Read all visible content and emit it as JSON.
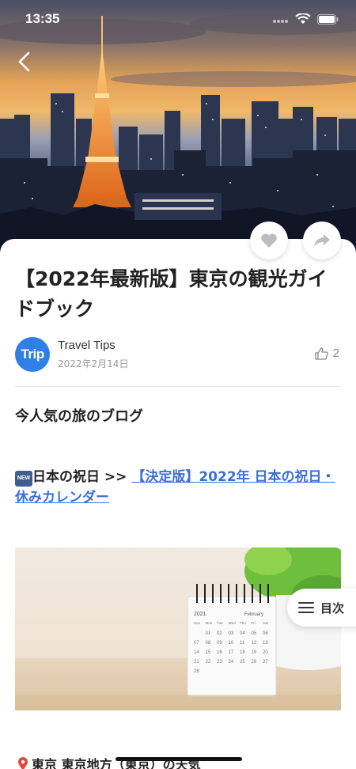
{
  "status_bar": {
    "time": "13:35"
  },
  "icons": {
    "back": "chevron-left-icon",
    "like": "heart-icon",
    "share": "share-arrow-icon",
    "thumbs_up": "thumbs-up-icon",
    "toc": "hamburger-menu-icon",
    "pin": "location-pin-icon"
  },
  "article": {
    "title": "【2022年最新版】東京の観光ガイドブック",
    "author": {
      "avatar_text": "Trip",
      "name": "Travel Tips",
      "date": "2022年2月14日"
    },
    "likes": "2"
  },
  "body": {
    "section_heading": "今人気の旅のブログ",
    "new_badge": "NEW",
    "link_prefix": "日本の祝日 >> ",
    "link_text": "【決定版】2022年 日本の祝日・休みカレンダー",
    "calendar": {
      "year": "2021",
      "month": "February",
      "weekdays": [
        "Sun",
        "Mon",
        "Tue",
        "Wed",
        "Thu",
        "Fri",
        "Sat"
      ],
      "rows": [
        [
          "",
          "01",
          "02",
          "03",
          "04",
          "05",
          "06"
        ],
        [
          "07",
          "08",
          "09",
          "10",
          "11",
          "12",
          "13"
        ],
        [
          "14",
          "15",
          "16",
          "17",
          "18",
          "19",
          "20"
        ],
        [
          "21",
          "22",
          "23",
          "24",
          "25",
          "26",
          "27"
        ],
        [
          "28",
          "",
          "",
          "",
          "",
          "",
          ""
        ]
      ]
    },
    "location_text": "東京 東京地方（東京）の天気"
  },
  "toc": {
    "label": "目次"
  },
  "colors": {
    "accent": "#3a6fd8",
    "avatar": "#2f7fe6"
  }
}
